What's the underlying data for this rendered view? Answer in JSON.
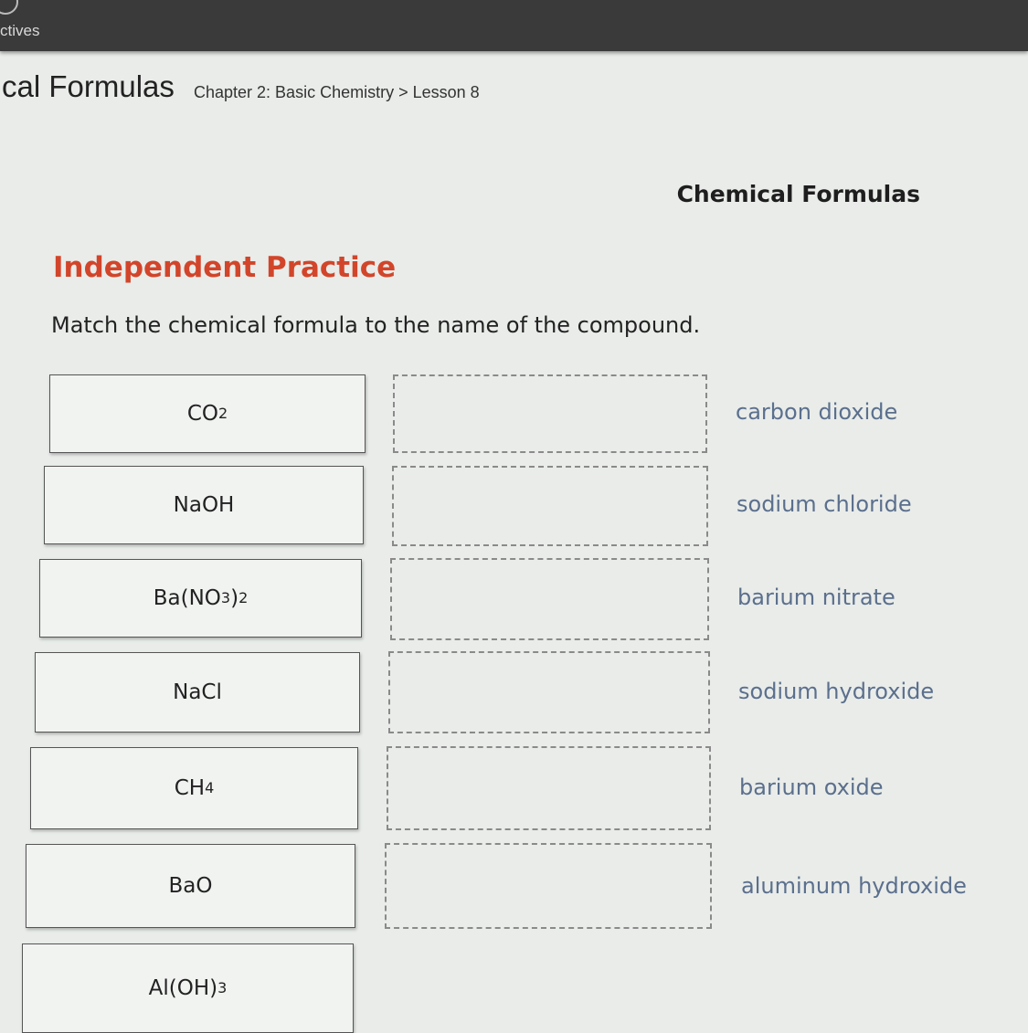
{
  "browser": {
    "tab_label": "ctives"
  },
  "header": {
    "title": "cal Formulas",
    "breadcrumb": "Chapter 2: Basic Chemistry > Lesson 8"
  },
  "activity": {
    "title": "Chemical Formulas",
    "section_heading": "Independent Practice",
    "instructions": "Match the chemical formula to the name of the compound."
  },
  "formulas": [
    {
      "base": "CO",
      "sub": "2",
      "tail": "",
      "tail_sub": ""
    },
    {
      "base": "NaOH",
      "sub": "",
      "tail": "",
      "tail_sub": ""
    },
    {
      "base": "Ba(NO",
      "sub": "3",
      "tail": ")",
      "tail_sub": "2"
    },
    {
      "base": "NaCl",
      "sub": "",
      "tail": "",
      "tail_sub": ""
    },
    {
      "base": "CH",
      "sub": "4",
      "tail": "",
      "tail_sub": ""
    },
    {
      "base": "BaO",
      "sub": "",
      "tail": "",
      "tail_sub": ""
    },
    {
      "base": "Al(OH)",
      "sub": "3",
      "tail": "",
      "tail_sub": ""
    }
  ],
  "compound_names": [
    "carbon dioxide",
    "sodium chloride",
    "barium nitrate",
    "sodium hydroxide",
    "barium oxide",
    "aluminum hydroxide"
  ],
  "colors": {
    "heading_accent": "#d2452a",
    "name_text": "#5b6f8d",
    "top_bar": "#3a3a3a"
  }
}
